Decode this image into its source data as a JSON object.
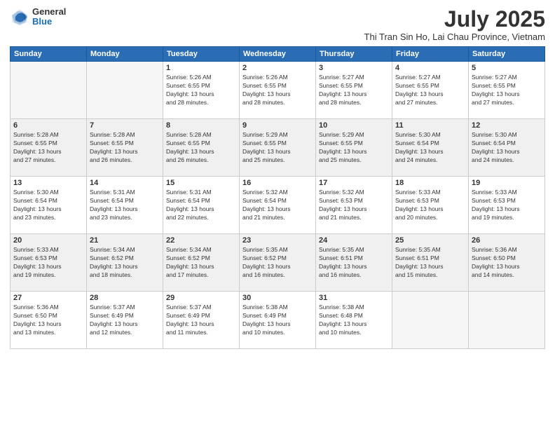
{
  "logo": {
    "general": "General",
    "blue": "Blue"
  },
  "title": {
    "month_year": "July 2025",
    "location": "Thi Tran Sin Ho, Lai Chau Province, Vietnam"
  },
  "weekdays": [
    "Sunday",
    "Monday",
    "Tuesday",
    "Wednesday",
    "Thursday",
    "Friday",
    "Saturday"
  ],
  "weeks": [
    [
      {
        "day": "",
        "info": ""
      },
      {
        "day": "",
        "info": ""
      },
      {
        "day": "1",
        "info": "Sunrise: 5:26 AM\nSunset: 6:55 PM\nDaylight: 13 hours\nand 28 minutes."
      },
      {
        "day": "2",
        "info": "Sunrise: 5:26 AM\nSunset: 6:55 PM\nDaylight: 13 hours\nand 28 minutes."
      },
      {
        "day": "3",
        "info": "Sunrise: 5:27 AM\nSunset: 6:55 PM\nDaylight: 13 hours\nand 28 minutes."
      },
      {
        "day": "4",
        "info": "Sunrise: 5:27 AM\nSunset: 6:55 PM\nDaylight: 13 hours\nand 27 minutes."
      },
      {
        "day": "5",
        "info": "Sunrise: 5:27 AM\nSunset: 6:55 PM\nDaylight: 13 hours\nand 27 minutes."
      }
    ],
    [
      {
        "day": "6",
        "info": "Sunrise: 5:28 AM\nSunset: 6:55 PM\nDaylight: 13 hours\nand 27 minutes."
      },
      {
        "day": "7",
        "info": "Sunrise: 5:28 AM\nSunset: 6:55 PM\nDaylight: 13 hours\nand 26 minutes."
      },
      {
        "day": "8",
        "info": "Sunrise: 5:28 AM\nSunset: 6:55 PM\nDaylight: 13 hours\nand 26 minutes."
      },
      {
        "day": "9",
        "info": "Sunrise: 5:29 AM\nSunset: 6:55 PM\nDaylight: 13 hours\nand 25 minutes."
      },
      {
        "day": "10",
        "info": "Sunrise: 5:29 AM\nSunset: 6:55 PM\nDaylight: 13 hours\nand 25 minutes."
      },
      {
        "day": "11",
        "info": "Sunrise: 5:30 AM\nSunset: 6:54 PM\nDaylight: 13 hours\nand 24 minutes."
      },
      {
        "day": "12",
        "info": "Sunrise: 5:30 AM\nSunset: 6:54 PM\nDaylight: 13 hours\nand 24 minutes."
      }
    ],
    [
      {
        "day": "13",
        "info": "Sunrise: 5:30 AM\nSunset: 6:54 PM\nDaylight: 13 hours\nand 23 minutes."
      },
      {
        "day": "14",
        "info": "Sunrise: 5:31 AM\nSunset: 6:54 PM\nDaylight: 13 hours\nand 23 minutes."
      },
      {
        "day": "15",
        "info": "Sunrise: 5:31 AM\nSunset: 6:54 PM\nDaylight: 13 hours\nand 22 minutes."
      },
      {
        "day": "16",
        "info": "Sunrise: 5:32 AM\nSunset: 6:54 PM\nDaylight: 13 hours\nand 21 minutes."
      },
      {
        "day": "17",
        "info": "Sunrise: 5:32 AM\nSunset: 6:53 PM\nDaylight: 13 hours\nand 21 minutes."
      },
      {
        "day": "18",
        "info": "Sunrise: 5:33 AM\nSunset: 6:53 PM\nDaylight: 13 hours\nand 20 minutes."
      },
      {
        "day": "19",
        "info": "Sunrise: 5:33 AM\nSunset: 6:53 PM\nDaylight: 13 hours\nand 19 minutes."
      }
    ],
    [
      {
        "day": "20",
        "info": "Sunrise: 5:33 AM\nSunset: 6:53 PM\nDaylight: 13 hours\nand 19 minutes."
      },
      {
        "day": "21",
        "info": "Sunrise: 5:34 AM\nSunset: 6:52 PM\nDaylight: 13 hours\nand 18 minutes."
      },
      {
        "day": "22",
        "info": "Sunrise: 5:34 AM\nSunset: 6:52 PM\nDaylight: 13 hours\nand 17 minutes."
      },
      {
        "day": "23",
        "info": "Sunrise: 5:35 AM\nSunset: 6:52 PM\nDaylight: 13 hours\nand 16 minutes."
      },
      {
        "day": "24",
        "info": "Sunrise: 5:35 AM\nSunset: 6:51 PM\nDaylight: 13 hours\nand 16 minutes."
      },
      {
        "day": "25",
        "info": "Sunrise: 5:35 AM\nSunset: 6:51 PM\nDaylight: 13 hours\nand 15 minutes."
      },
      {
        "day": "26",
        "info": "Sunrise: 5:36 AM\nSunset: 6:50 PM\nDaylight: 13 hours\nand 14 minutes."
      }
    ],
    [
      {
        "day": "27",
        "info": "Sunrise: 5:36 AM\nSunset: 6:50 PM\nDaylight: 13 hours\nand 13 minutes."
      },
      {
        "day": "28",
        "info": "Sunrise: 5:37 AM\nSunset: 6:49 PM\nDaylight: 13 hours\nand 12 minutes."
      },
      {
        "day": "29",
        "info": "Sunrise: 5:37 AM\nSunset: 6:49 PM\nDaylight: 13 hours\nand 11 minutes."
      },
      {
        "day": "30",
        "info": "Sunrise: 5:38 AM\nSunset: 6:49 PM\nDaylight: 13 hours\nand 10 minutes."
      },
      {
        "day": "31",
        "info": "Sunrise: 5:38 AM\nSunset: 6:48 PM\nDaylight: 13 hours\nand 10 minutes."
      },
      {
        "day": "",
        "info": ""
      },
      {
        "day": "",
        "info": ""
      }
    ]
  ]
}
